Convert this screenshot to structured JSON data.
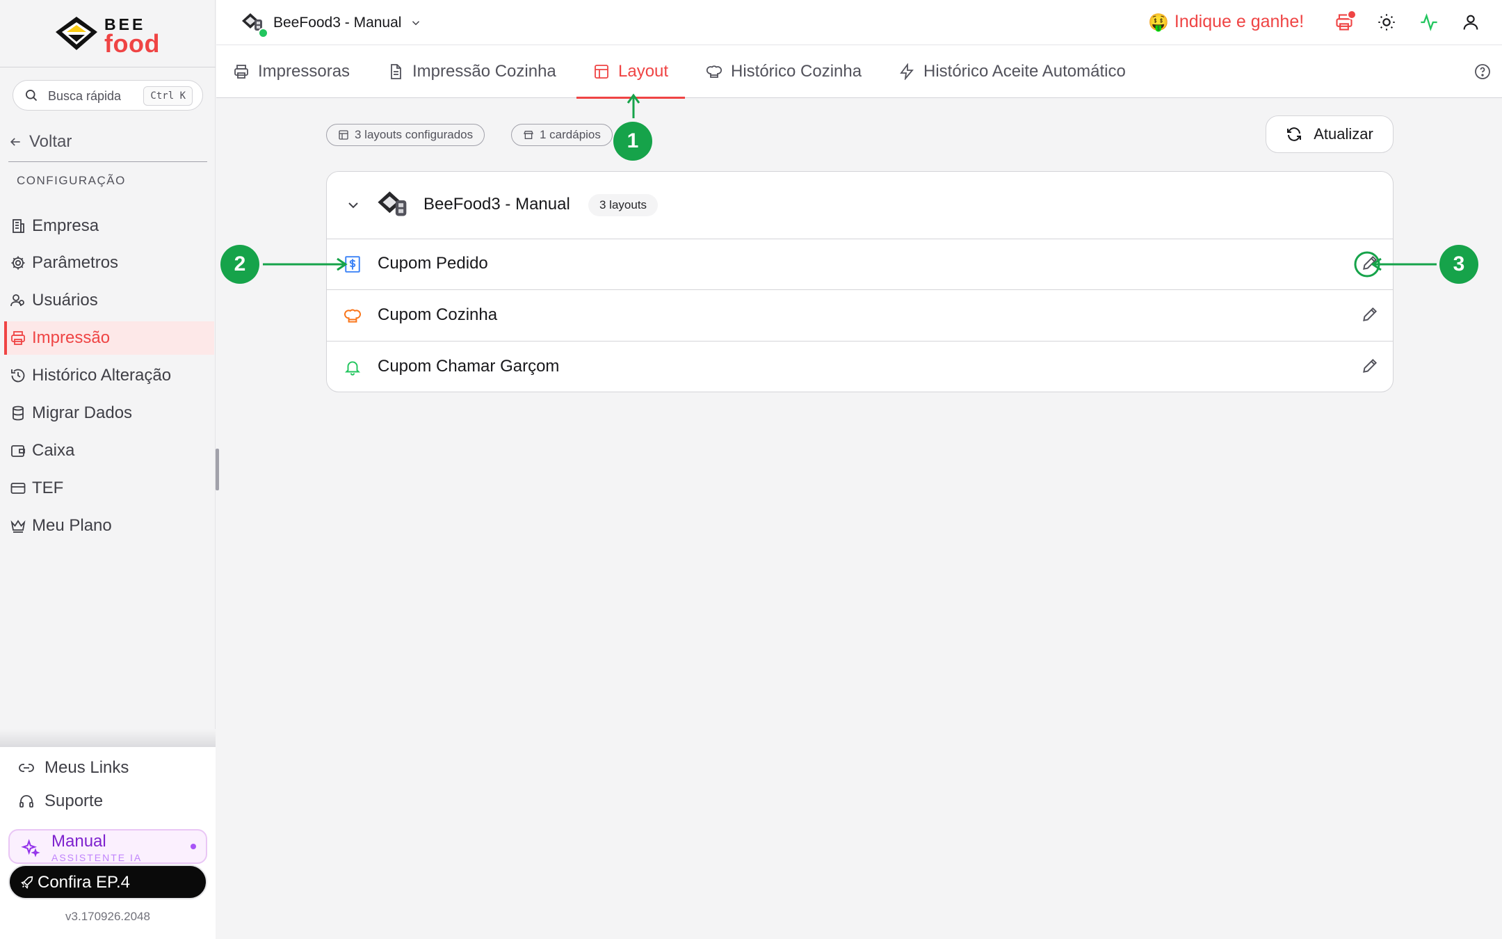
{
  "app": {
    "logo_top": "BEE",
    "logo_bottom": "food",
    "store_name": "BeeFood3 - Manual",
    "refer_text": "Indique e ganhe!",
    "refer_emoji": "🤑"
  },
  "search": {
    "placeholder": "Busca rápida",
    "shortcut": "Ctrl K"
  },
  "sidebar": {
    "back_label": "Voltar",
    "section_title": "CONFIGURAÇÃO",
    "items": [
      {
        "label": "Empresa",
        "icon": "building-icon",
        "active": false
      },
      {
        "label": "Parâmetros",
        "icon": "gear-icon",
        "active": false
      },
      {
        "label": "Usuários",
        "icon": "users-icon",
        "active": false
      },
      {
        "label": "Impressão",
        "icon": "printer-icon",
        "active": true
      },
      {
        "label": "Histórico Alteração",
        "icon": "history-icon",
        "active": false
      },
      {
        "label": "Migrar Dados",
        "icon": "database-icon",
        "active": false
      },
      {
        "label": "Caixa",
        "icon": "wallet-icon",
        "active": false
      },
      {
        "label": "TEF",
        "icon": "credit-card-icon",
        "active": false
      },
      {
        "label": "Meu Plano",
        "icon": "crown-icon",
        "active": false
      }
    ],
    "bottom_links": [
      {
        "label": "Meus Links",
        "icon": "link-icon"
      },
      {
        "label": "Suporte",
        "icon": "headset-icon"
      }
    ],
    "assistant": {
      "title": "Manual",
      "subtitle": "ASSISTENTE IA"
    },
    "promo": {
      "label": "Confira EP.4"
    },
    "version": "v3.170926.2048"
  },
  "tabs": [
    {
      "label": "Impressoras",
      "icon": "printer-icon",
      "active": false
    },
    {
      "label": "Impressão Cozinha",
      "icon": "document-icon",
      "active": false
    },
    {
      "label": "Layout",
      "icon": "layout-icon",
      "active": true
    },
    {
      "label": "Histórico Cozinha",
      "icon": "chef-hat-icon",
      "active": false
    },
    {
      "label": "Histórico Aceite Automático",
      "icon": "lightning-icon",
      "active": false
    }
  ],
  "summary": {
    "layouts_badge": "3 layouts configurados",
    "menus_badge": "1 cardápios",
    "refresh_label": "Atualizar"
  },
  "store_card": {
    "name": "BeeFood3 - Manual",
    "count_badge": "3 layouts",
    "layouts": [
      {
        "label": "Cupom Pedido",
        "icon": "receipt-dollar-icon",
        "color": "#3b82f6"
      },
      {
        "label": "Cupom Cozinha",
        "icon": "chef-hat-icon",
        "color": "#f97316"
      },
      {
        "label": "Cupom Chamar Garçom",
        "icon": "bell-icon",
        "color": "#22c55e"
      }
    ]
  },
  "annotations": [
    "1",
    "2",
    "3"
  ],
  "colors": {
    "accent": "#ef4444",
    "annotation": "#16a34a",
    "assistant": "#7e22ce"
  }
}
